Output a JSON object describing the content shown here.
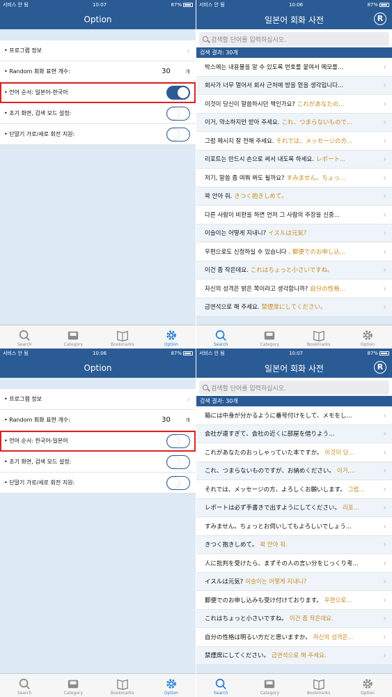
{
  "colors": {
    "accent": "#2a5b95",
    "tab_active": "#2a7fd4",
    "japanese_text": "#c98a1e",
    "highlight": "#e02020"
  },
  "status_bar": {
    "carrier": "서비스 안 됨",
    "battery": "87%",
    "time_top_left": "10:07",
    "time_top_right": "10:06",
    "time_bottom_left": "10:06",
    "time_bottom_right": "10:07"
  },
  "option_screen": {
    "title": "Option",
    "rows": {
      "program_info": "• 프로그램 정보",
      "random_count": "• Random 회화 표현 개수:",
      "random_value": "30",
      "random_unit": "개",
      "language_order_ko_first": "• 언어 순서:  일본어-한국어",
      "language_order_jp_first": "• 언어 순서:  한국어-일본어",
      "initial_screen": "• 초기 화면, 검색 모드 설정:",
      "rotation": "• 단말기 가로/세로 회전 지원:"
    },
    "language_toggle_top": "on",
    "language_toggle_bottom": "off"
  },
  "search_screen": {
    "title": "일본어 회화 사전",
    "title_icon": "R",
    "search_placeholder": "검색할 단어를 입력하십시오.",
    "result_count": "검색 결과: 30개",
    "results_korean_first": [
      {
        "main": "박스에는 내용물을 알 수 있도록 번호를 붙여서 메모를...",
        "sub": ""
      },
      {
        "main": "회사가 너무 멀어서 회사 근처에 방을 얻을 생각입니다...",
        "sub": ""
      },
      {
        "main": "이것이 당신이 말씀하시던 책인가요?",
        "sub": "これがあなたの..."
      },
      {
        "main": "이거, 약소하지만 받아 주세요.",
        "sub": "これ、つまらないもので..."
      },
      {
        "main": "그럼 메시지 잘 전해 주세요.",
        "sub": "それでは、メッセージの方..."
      },
      {
        "main": "리포트는 반드시 손으로 써서 내도록 하세요.",
        "sub": "レポート..."
      },
      {
        "main": "저기, 말씀 좀 여쭤 봐도 될까요?",
        "sub": "すみません。ちょっ..."
      },
      {
        "main": "꽉 안아 줘.",
        "sub": "きつく抱きしめて。"
      },
      {
        "main": "다른 사람이 비판을 하면 먼저 그 사람의 주장을 신중...",
        "sub": ""
      },
      {
        "main": "이슬이는 어떻게 지내니?",
        "sub": "イスルは元気?"
      },
      {
        "main": "우편으로도 신청하실 수 있습니다 .",
        "sub": "郵便でのお申し込..."
      },
      {
        "main": "이건 좀 작은데요.",
        "sub": "これはちょっと小さいですね。"
      },
      {
        "main": "자신의 성격은 밝은 쪽이라고 생각합니까?",
        "sub": "自分の性格..."
      },
      {
        "main": "금연석으로 해 주세요.",
        "sub": "禁煙席にしてください。"
      }
    ],
    "results_japanese_first": [
      {
        "main": "箱には中身が分かるように番号付けをして、メモをし...",
        "sub": ""
      },
      {
        "main": "会社が遠すぎて、会社の近くに部屋を借りよう...",
        "sub": ""
      },
      {
        "main": "これがあなたのおっしゃっていた本ですか。",
        "sub": "이것이 당..."
      },
      {
        "main": "これ、つまらないものですが、お納めください。",
        "sub": "이거,..."
      },
      {
        "main": "それでは、メッセージの方、よろしくお願いします。",
        "sub": "그럼..."
      },
      {
        "main": "レポートは必ず手書きで出すようにしてください。",
        "sub": "리포..."
      },
      {
        "main": "すみません。ちょっとお伺いしてもよろしいでしょう...",
        "sub": ""
      },
      {
        "main": "きつく抱きしめて。",
        "sub": "꽉 안아 줘."
      },
      {
        "main": "人に批判を受けたら、まずその人の言い分をじっくり考...",
        "sub": ""
      },
      {
        "main": "イスルは元気?",
        "sub": "이슬이는 어떻게 지내니?"
      },
      {
        "main": "郵便でのお申し込みも受け付けております。",
        "sub": "우편으로..."
      },
      {
        "main": "これはちょっと小さいですね。",
        "sub": "이건 좀 작은데요."
      },
      {
        "main": "自分の性格は明るい方だと思いますか。",
        "sub": "자신의 성격은..."
      },
      {
        "main": "禁煙席にしてください。",
        "sub": "금연석으로 해 주세요."
      }
    ]
  },
  "tab_bar": {
    "search": "Search",
    "category": "Category",
    "bookmarks": "Bookmarks",
    "option": "Option"
  }
}
